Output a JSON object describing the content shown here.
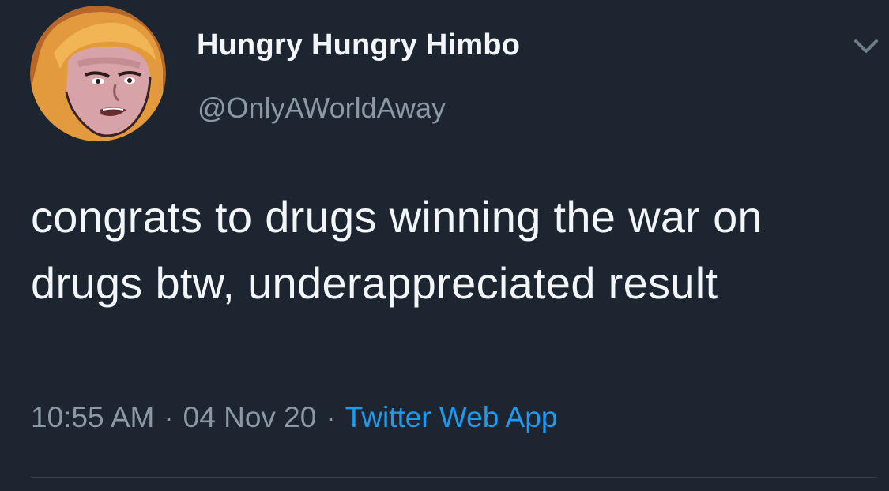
{
  "user": {
    "display_name": "Hungry Hungry Himbo",
    "handle": "@OnlyAWorldAway",
    "avatar_icon": "cartoon-hero-avatar"
  },
  "tweet": {
    "text": "congrats to drugs winning the war on drugs btw, underappreciated result",
    "time": "10:55 AM",
    "date": "04 Nov 20",
    "separator": "·",
    "source": "Twitter Web App"
  },
  "menu": {
    "icon": "chevron-down-icon"
  },
  "colors": {
    "background": "#1c2530",
    "text": "#f3f6f8",
    "muted": "#8b98a5",
    "accent": "#1d9bf0"
  }
}
